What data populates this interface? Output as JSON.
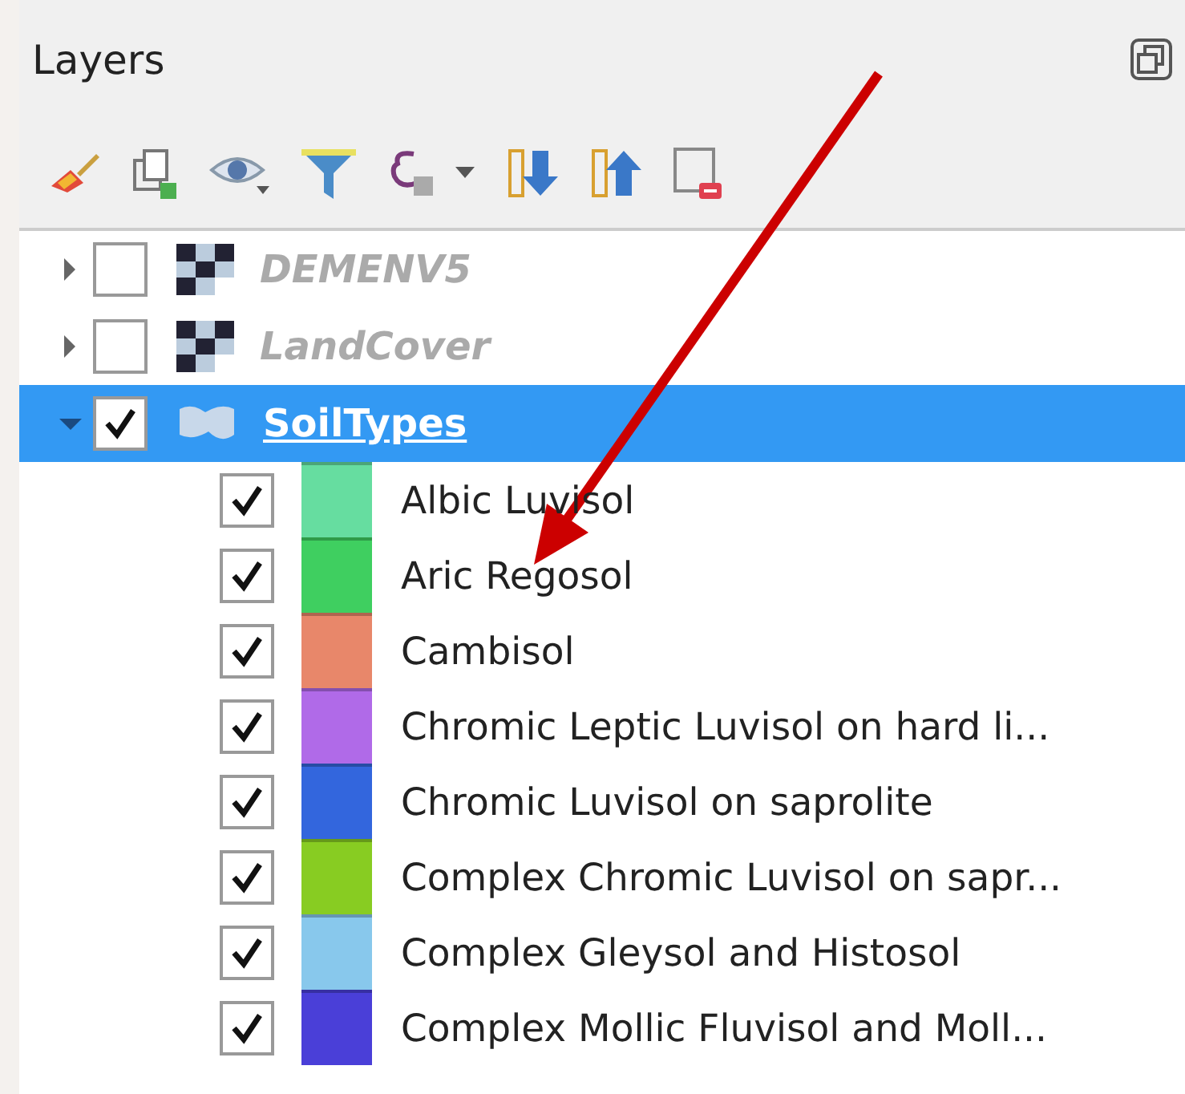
{
  "panel": {
    "title": "Layers"
  },
  "layers": [
    {
      "name": "DEMENV5",
      "kind": "raster",
      "expanded": false,
      "checked": false,
      "selected": false,
      "disabled": true
    },
    {
      "name": "LandCover",
      "kind": "raster",
      "expanded": false,
      "checked": false,
      "selected": false,
      "disabled": true
    },
    {
      "name": "SoilTypes",
      "kind": "vector",
      "expanded": true,
      "checked": true,
      "selected": true,
      "disabled": false,
      "children": [
        {
          "label": "Albic Luvisol",
          "checked": true,
          "color": "#66dda0"
        },
        {
          "label": "Aric Regosol",
          "checked": true,
          "color": "#3fcf60"
        },
        {
          "label": "Cambisol",
          "checked": true,
          "color": "#e8876a"
        },
        {
          "label": "Chromic Leptic Luvisol on hard li...",
          "checked": true,
          "color": "#b06ae8"
        },
        {
          "label": "Chromic Luvisol on saprolite",
          "checked": true,
          "color": "#3366dd"
        },
        {
          "label": "Complex Chromic Luvisol on sapr...",
          "checked": true,
          "color": "#88cc22"
        },
        {
          "label": "Complex Gleysol and Histosol",
          "checked": true,
          "color": "#88c8ec"
        },
        {
          "label": "Complex Mollic Fluvisol and Moll...",
          "checked": true,
          "color": "#4a3fd8"
        }
      ]
    }
  ]
}
